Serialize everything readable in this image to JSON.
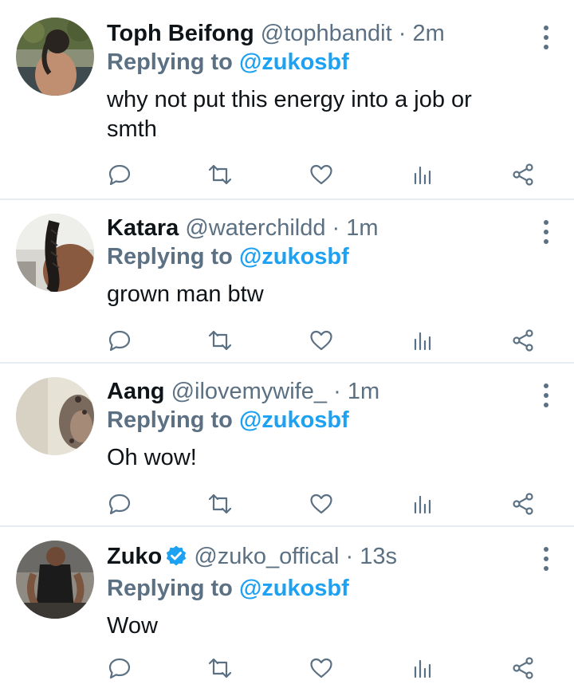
{
  "reply_prefix": "Replying to",
  "colors": {
    "accent": "#1da1f2",
    "muted": "#5b7083",
    "text": "#0f1419",
    "divider": "#e6ecf0"
  },
  "tweets": [
    {
      "name": "Toph Beifong",
      "handle": "@tophbandit",
      "separator": "·",
      "time": "2m",
      "replying_to": "@zukosbf",
      "text": "why not put this energy into a job or smth",
      "verified": false
    },
    {
      "name": "Katara",
      "handle": "@waterchildd",
      "separator": "·",
      "time": "1m",
      "replying_to": "@zukosbf",
      "text": "grown man btw",
      "verified": false
    },
    {
      "name": "Aang",
      "handle": "@ilovemywife_",
      "separator": "·",
      "time": "1m",
      "replying_to": "@zukosbf",
      "text": "Oh wow!",
      "verified": false
    },
    {
      "name": "Zuko",
      "handle": "@zuko_offical",
      "separator": "·",
      "time": "13s",
      "replying_to": "@zukosbf",
      "text": "Wow",
      "verified": true
    }
  ],
  "icons": [
    "reply-icon",
    "retweet-icon",
    "like-icon",
    "analytics-icon",
    "share-icon",
    "more-icon",
    "verified-badge-icon"
  ]
}
